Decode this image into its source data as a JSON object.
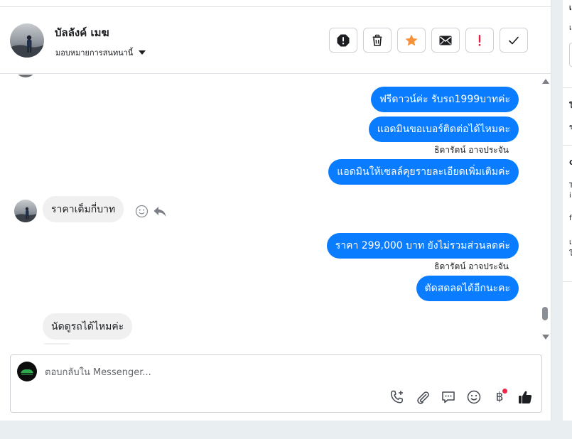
{
  "contact": {
    "name": "บัลลังค์ เมฆ",
    "assign_label": "มอบหมายการสนทนานี้"
  },
  "actions": [
    {
      "name": "spam-button",
      "icon": "alert-octagon-icon"
    },
    {
      "name": "delete-button",
      "icon": "trash-icon"
    },
    {
      "name": "star-button",
      "icon": "star-icon"
    },
    {
      "name": "mark-unread-button",
      "icon": "envelope-icon"
    },
    {
      "name": "follow-up-button",
      "icon": "exclamation-icon"
    },
    {
      "name": "mark-done-button",
      "icon": "checkmark-icon"
    }
  ],
  "messages": [
    {
      "dir": "out",
      "text": "ฟรีดาวน์ค่ะ รับรถ1999บาทค่ะ"
    },
    {
      "dir": "out",
      "text": "แอดมินขอเบอร์ติดต่อได้ไหมคะ"
    },
    {
      "dir": "sender",
      "text": "ธิดารัตน์ อาจประจัน"
    },
    {
      "dir": "out",
      "text": "แอดมินให้เซลล์คุยรายละเอียดเพิ่มเติมค่ะ"
    },
    {
      "dir": "in",
      "text": "ราคาเต็มกี่บาท"
    },
    {
      "dir": "out",
      "text": "ราคา 299,000 บาท ยังไม่รวมส่วนลดค่ะ"
    },
    {
      "dir": "sender",
      "text": "ธิดารัตน์ อาจประจัน"
    },
    {
      "dir": "out",
      "text": "ตัดสดลดได้อีกนะคะ"
    },
    {
      "dir": "in",
      "text": "นัดดูรถได้ไหมค่ะ"
    }
  ],
  "composer": {
    "placeholder": "ตอบกลับใน Messenger..."
  },
  "composer_tools": [
    "call-add-icon",
    "paperclip-icon",
    "saved-reply-icon",
    "emoji-icon",
    "baht-payment-icon",
    "thumbs-up-icon"
  ],
  "baht_symbol": "฿",
  "colors": {
    "accent": "#0a7cff",
    "incoming_bubble": "#f0f0f0",
    "star": "#f7923b",
    "alert": "#e41e3f",
    "notification_dot": "#f02849"
  },
  "side_fragments": [
    "เ",
    "เ",
    "ใ",
    "ข",
    "C",
    "T",
    "i",
    "f",
    "เ",
    "ใ"
  ]
}
